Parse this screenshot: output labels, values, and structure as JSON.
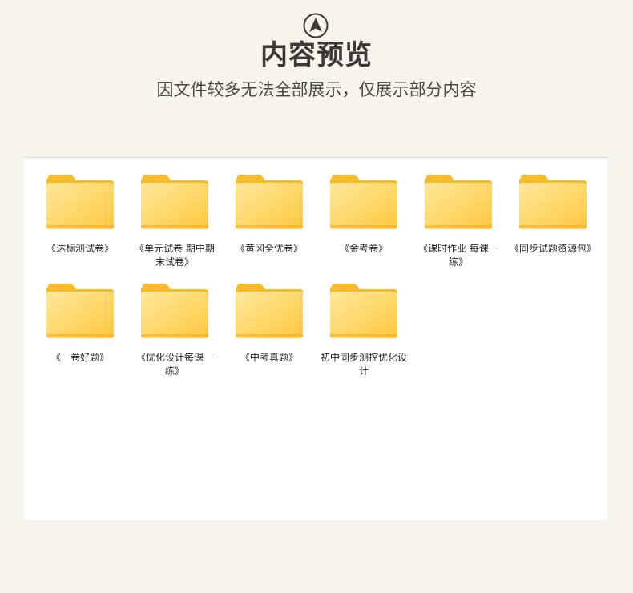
{
  "header": {
    "logo_icon": "navigation-arrow-icon",
    "title": "内容预览",
    "subtitle": "因文件较多无法全部展示，仅展示部分内容"
  },
  "folders": [
    {
      "label": "《达标测试卷》"
    },
    {
      "label": "《单元试卷 期中期末试卷》"
    },
    {
      "label": "《黄冈全优卷》"
    },
    {
      "label": "《金考卷》"
    },
    {
      "label": "《课时作业 每课一练》"
    },
    {
      "label": "《同步试题资源包》"
    },
    {
      "label": "《一卷好题》"
    },
    {
      "label": "《优化设计每课一练》"
    },
    {
      "label": "《中考真题》"
    },
    {
      "label": "初中同步测控优化设计"
    }
  ],
  "colors": {
    "background": "#f7f4ee",
    "panel": "#ffffff",
    "folder_back": "#f5b82a",
    "folder_front": "#ffd766"
  }
}
